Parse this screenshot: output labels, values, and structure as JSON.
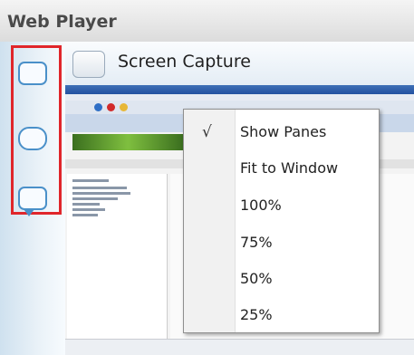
{
  "window": {
    "title": "Web Player"
  },
  "toolbar": {
    "capture_label": "Screen Capture"
  },
  "tools": [
    {
      "name": "rectangle-tool",
      "icon": "rounded-rectangle-icon"
    },
    {
      "name": "ellipse-tool",
      "icon": "rounded-ellipse-icon"
    },
    {
      "name": "callout-tool",
      "icon": "speech-callout-icon"
    }
  ],
  "context_menu": {
    "checkmark": "√",
    "items": [
      {
        "label": "Show Panes",
        "checked": true
      },
      {
        "label": "Fit to Window",
        "checked": false
      },
      {
        "label": "100%",
        "checked": false
      },
      {
        "label": "75%",
        "checked": false
      },
      {
        "label": "50%",
        "checked": false
      },
      {
        "label": "25%",
        "checked": false
      }
    ]
  },
  "colors": {
    "highlight_border": "#e0262b",
    "tool_accent": "#4a90c9"
  }
}
